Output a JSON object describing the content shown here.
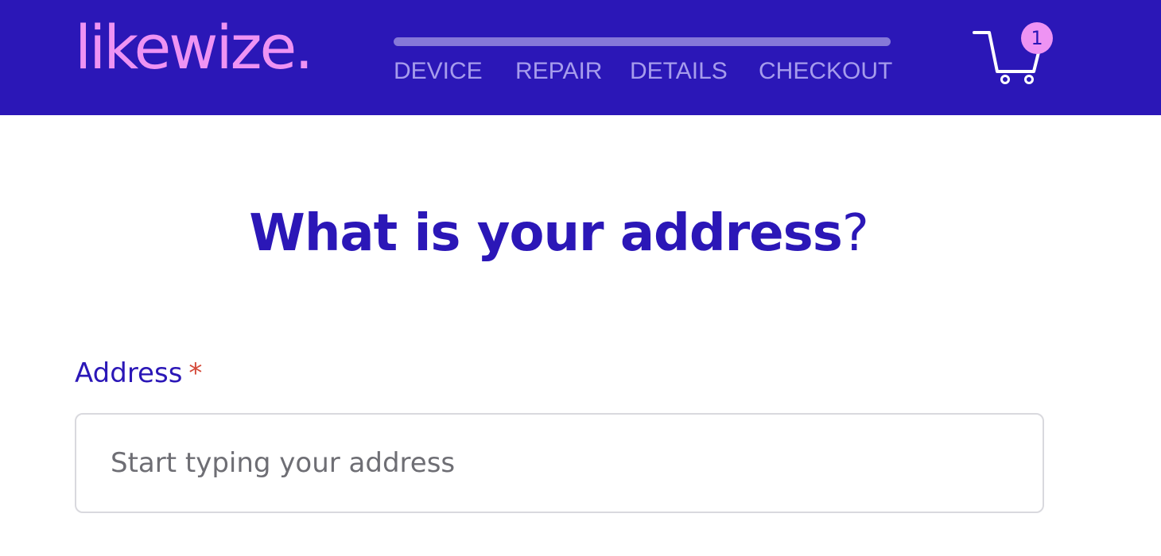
{
  "header": {
    "logo_text": "likewize.",
    "steps": [
      {
        "label": "DEVICE"
      },
      {
        "label": "REPAIR"
      },
      {
        "label": "DETAILS"
      },
      {
        "label": "CHECKOUT"
      }
    ],
    "cart": {
      "icon": "cart-icon",
      "count": "1"
    }
  },
  "main": {
    "title": "What is your address",
    "title_suffix": "?",
    "address": {
      "label": "Address",
      "required_mark": "*",
      "placeholder": "Start typing your address",
      "value": ""
    }
  },
  "colors": {
    "brand": "#2b17b7",
    "accent": "#ee93f3",
    "step_inactive": "#a69cec",
    "required": "#d44a3a"
  }
}
